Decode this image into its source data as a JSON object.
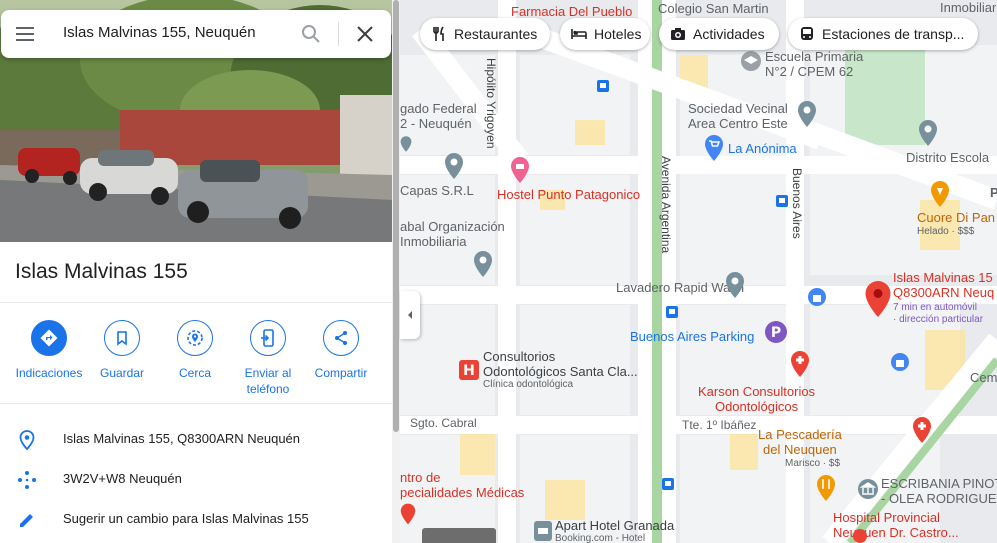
{
  "search": {
    "query": "Islas Malvinas 155, Neuquén"
  },
  "place": {
    "title": "Islas Malvinas 155"
  },
  "actions": [
    {
      "label": "Indicaciones"
    },
    {
      "label": "Guardar"
    },
    {
      "label": "Cerca"
    },
    {
      "label": "Enviar al teléfono"
    },
    {
      "label": "Compartir"
    }
  ],
  "info": {
    "address": "Islas Malvinas 155, Q8300ARN Neuquén",
    "plus_code": "3W2V+W8 Neuquén",
    "suggest": "Sugerir un cambio para Islas Malvinas 155"
  },
  "chips": [
    {
      "label": "Restaurantes",
      "icon": "fork-knife-icon"
    },
    {
      "label": "Hoteles",
      "icon": "bed-icon"
    },
    {
      "label": "Actividades",
      "icon": "camera-icon"
    },
    {
      "label": "Estaciones de transp...",
      "icon": "bus-icon"
    }
  ],
  "map": {
    "labels": {
      "farmacia": "Farmacia Del Pueblo",
      "colegio": "Colegio San Martin",
      "inmobiliaria_top": "Inmobiliaria D",
      "escuela": "Escuela Primaria\nN°2 / CPEM 62",
      "sociedad": "Sociedad Vecinal\nArea Centro Este",
      "anonima": "La Anónima",
      "distrito": "Distrito Escola",
      "delegado": "gado Federal\n2 - Neuquén",
      "hostel": "Hostel Punto Patagonico",
      "capas": "Capas S.R.L",
      "cuore": "Cuore Di Pan",
      "cuore_sub": "Helado · $$$",
      "organizacion": "abal Organización\nInmobiliaria",
      "lavadero": "Lavadero Rapid Wash",
      "target": "Islas Malvinas 15\nQ8300ARN Neuq",
      "target_sub": "7 min en automóvil\n· dirección particular",
      "parking": "Buenos Aires Parking",
      "consultorios": "Consultorios\nOdontológicos Santa Cla...",
      "consultorios_sub": "Clínica odontológica",
      "karson": "Karson Consultorios\nOdontológicos",
      "cem": "Cem",
      "pescaderia": "La Pescadería\ndel Neuquen",
      "pescaderia_sub": "Marisco · $$",
      "sgto": "Sgto. Cabral",
      "ibanez": "Tte. 1º Ibáñez",
      "centro": "ntro de\npecialidades Médicas",
      "escribania": "ESCRIBANIA PINOT\n- OLEA RODRIGUEZ",
      "hospital": "Hospital Provincial\nNeuquen Dr. Castro...",
      "apart": "Apart Hotel Granada",
      "apart_sub": "Booking.com - Hotel",
      "p_label": "P"
    },
    "streets": {
      "hipolito": "Hipólito Yrigoyen",
      "avenida": "Avenida Argentina",
      "buenos_aires": "Buenos Aires"
    }
  },
  "colors": {
    "accent": "#1a73e8",
    "pin_red": "#ea4335",
    "park_green": "#c8e6c9"
  }
}
